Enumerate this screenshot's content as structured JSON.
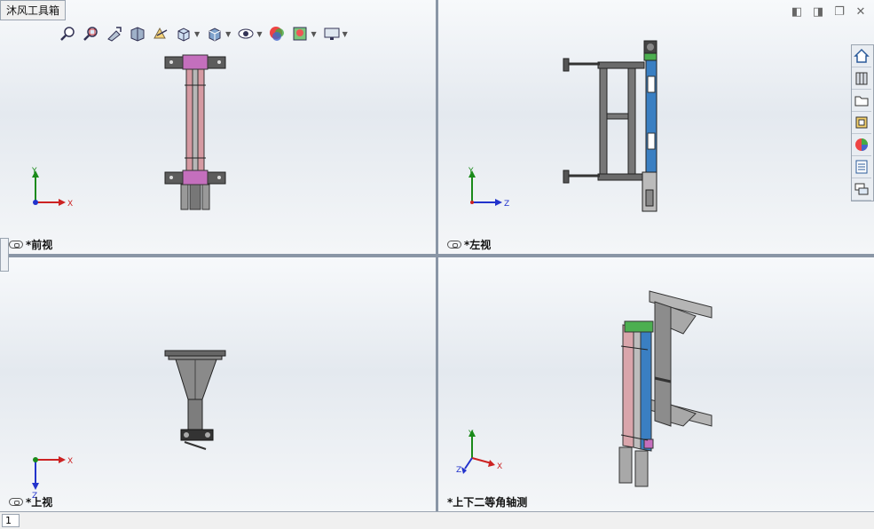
{
  "addon_tab": {
    "label": "沐风工具箱"
  },
  "toolbar": {
    "icons": [
      "zoom-to-fit-icon",
      "zoom-area-icon",
      "previous-view-icon",
      "section-view-icon",
      "dynamic-annotation-icon",
      "view-orientation-icon",
      "display-style-icon",
      "hide-show-icon",
      "edit-appearance-icon",
      "apply-scene-icon",
      "view-settings-icon"
    ]
  },
  "window_controls": {
    "prev": "◧",
    "next": "◨",
    "restore": "❐",
    "close": "✕"
  },
  "views": {
    "front": {
      "label": "*前视",
      "axis1": "Y",
      "axis2": "X"
    },
    "left": {
      "label": "*左视",
      "axis1": "Y",
      "axis2": "Z"
    },
    "top": {
      "label": "*上视",
      "axis1": "X",
      "axis2": "Z"
    },
    "iso": {
      "label": "*上下二等角轴测",
      "axis1": "Y",
      "axis2": "X",
      "axis3": "Z"
    }
  },
  "taskpane": {
    "icons": [
      "home-icon",
      "design-library-icon",
      "file-explorer-icon",
      "view-palette-icon",
      "appearances-icon",
      "custom-properties-icon",
      "forum-icon"
    ]
  },
  "status": {
    "tab_label": "1"
  }
}
